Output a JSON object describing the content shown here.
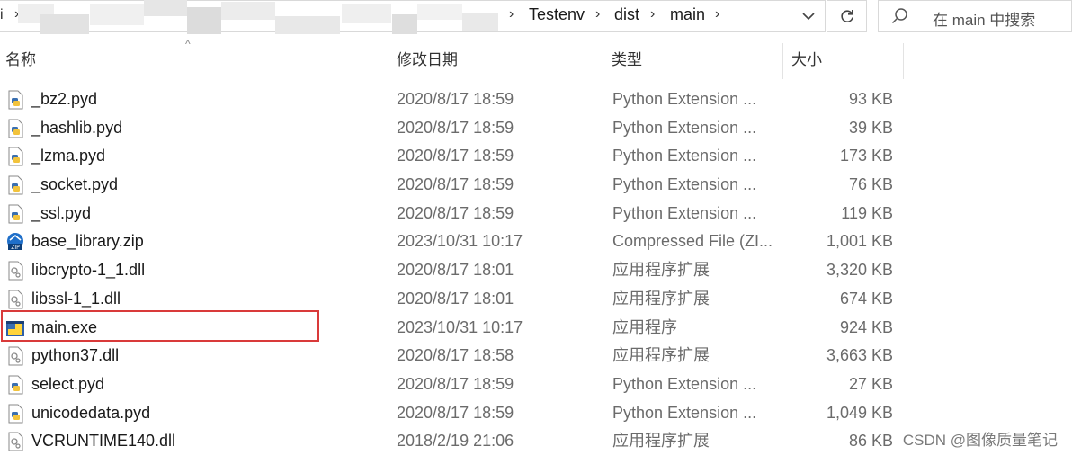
{
  "address_bar": {
    "edge_glyph": "i",
    "crumbs": [
      "Testenv",
      "dist",
      "main"
    ],
    "dropdown_icon": "chevron-down-icon",
    "refresh_icon": "refresh-icon"
  },
  "search": {
    "placeholder": "在 main 中搜索"
  },
  "columns": {
    "name": "名称",
    "date": "修改日期",
    "type": "类型",
    "size": "大小"
  },
  "files": [
    {
      "name": "_bz2.pyd",
      "date": "2020/8/17 18:59",
      "type": "Python Extension ...",
      "size": "93 KB",
      "icon": "python-file-icon"
    },
    {
      "name": "_hashlib.pyd",
      "date": "2020/8/17 18:59",
      "type": "Python Extension ...",
      "size": "39 KB",
      "icon": "python-file-icon"
    },
    {
      "name": "_lzma.pyd",
      "date": "2020/8/17 18:59",
      "type": "Python Extension ...",
      "size": "173 KB",
      "icon": "python-file-icon"
    },
    {
      "name": "_socket.pyd",
      "date": "2020/8/17 18:59",
      "type": "Python Extension ...",
      "size": "76 KB",
      "icon": "python-file-icon"
    },
    {
      "name": "_ssl.pyd",
      "date": "2020/8/17 18:59",
      "type": "Python Extension ...",
      "size": "119 KB",
      "icon": "python-file-icon"
    },
    {
      "name": "base_library.zip",
      "date": "2023/10/31 10:17",
      "type": "Compressed File (ZI...",
      "size": "1,001 KB",
      "icon": "zip-file-icon"
    },
    {
      "name": "libcrypto-1_1.dll",
      "date": "2020/8/17 18:01",
      "type": "应用程序扩展",
      "size": "3,320 KB",
      "icon": "dll-file-icon"
    },
    {
      "name": "libssl-1_1.dll",
      "date": "2020/8/17 18:01",
      "type": "应用程序扩展",
      "size": "674 KB",
      "icon": "dll-file-icon"
    },
    {
      "name": "main.exe",
      "date": "2023/10/31 10:17",
      "type": "应用程序",
      "size": "924 KB",
      "icon": "exe-file-icon",
      "highlighted": true
    },
    {
      "name": "python37.dll",
      "date": "2020/8/17 18:58",
      "type": "应用程序扩展",
      "size": "3,663 KB",
      "icon": "dll-file-icon"
    },
    {
      "name": "select.pyd",
      "date": "2020/8/17 18:59",
      "type": "Python Extension ...",
      "size": "27 KB",
      "icon": "python-file-icon"
    },
    {
      "name": "unicodedata.pyd",
      "date": "2020/8/17 18:59",
      "type": "Python Extension ...",
      "size": "1,049 KB",
      "icon": "python-file-icon"
    },
    {
      "name": "VCRUNTIME140.dll",
      "date": "2018/2/19 21:06",
      "type": "应用程序扩展",
      "size": "86 KB",
      "icon": "dll-file-icon"
    }
  ],
  "highlight_color": "#d93a3a",
  "watermark": "CSDN @图像质量笔记"
}
